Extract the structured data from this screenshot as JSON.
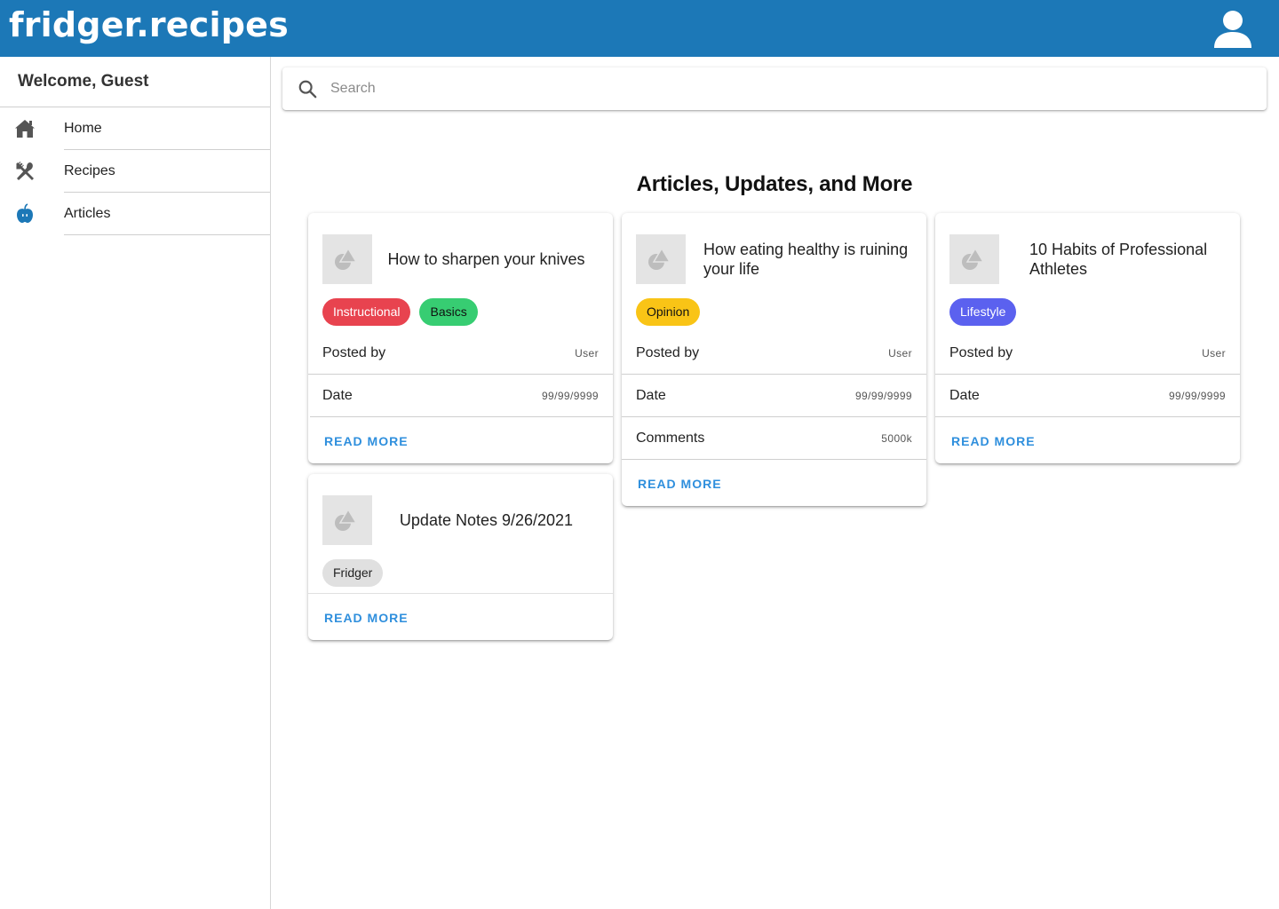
{
  "header": {
    "logo": "fridger.recipes",
    "account_icon": "account-icon"
  },
  "sidebar": {
    "welcome": "Welcome, Guest",
    "items": [
      {
        "label": "Home",
        "icon": "home-icon"
      },
      {
        "label": "Recipes",
        "icon": "utensils-icon"
      },
      {
        "label": "Articles",
        "icon": "apple-icon",
        "active_color": "#1c78b7"
      }
    ]
  },
  "search": {
    "placeholder": "Search",
    "value": ""
  },
  "main": {
    "title": "Articles, Updates, and More",
    "cards": [
      {
        "title": "How to sharpen your knives",
        "tags": [
          {
            "label": "Instructional",
            "color": "#e8434f"
          },
          {
            "label": "Basics",
            "color": "#37cd72"
          }
        ],
        "posted_by_label": "Posted by",
        "posted_by": "User",
        "date_label": "Date",
        "date": "99/99/9999",
        "action": "READ MORE"
      },
      {
        "title": "How eating healthy is ruining your life",
        "tags": [
          {
            "label": "Opinion",
            "color": "#f9c416"
          }
        ],
        "posted_by_label": "Posted by",
        "posted_by": "User",
        "date_label": "Date",
        "date": "99/99/9999",
        "comments_label": "Comments",
        "comments": "5000k",
        "action": "READ MORE"
      },
      {
        "title": "10 Habits of Professional Athletes",
        "tags": [
          {
            "label": "Lifestyle",
            "color": "#5b61ef"
          }
        ],
        "posted_by_label": "Posted by",
        "posted_by": "User",
        "date_label": "Date",
        "date": "99/99/9999",
        "action": "READ MORE"
      },
      {
        "title": "Update Notes 9/26/2021",
        "tags": [
          {
            "label": "Fridger",
            "color": "#e0e0e0"
          }
        ],
        "action": "READ MORE"
      }
    ]
  },
  "colors": {
    "appbar": "#1c78b7",
    "link": "#2f8fdd"
  }
}
